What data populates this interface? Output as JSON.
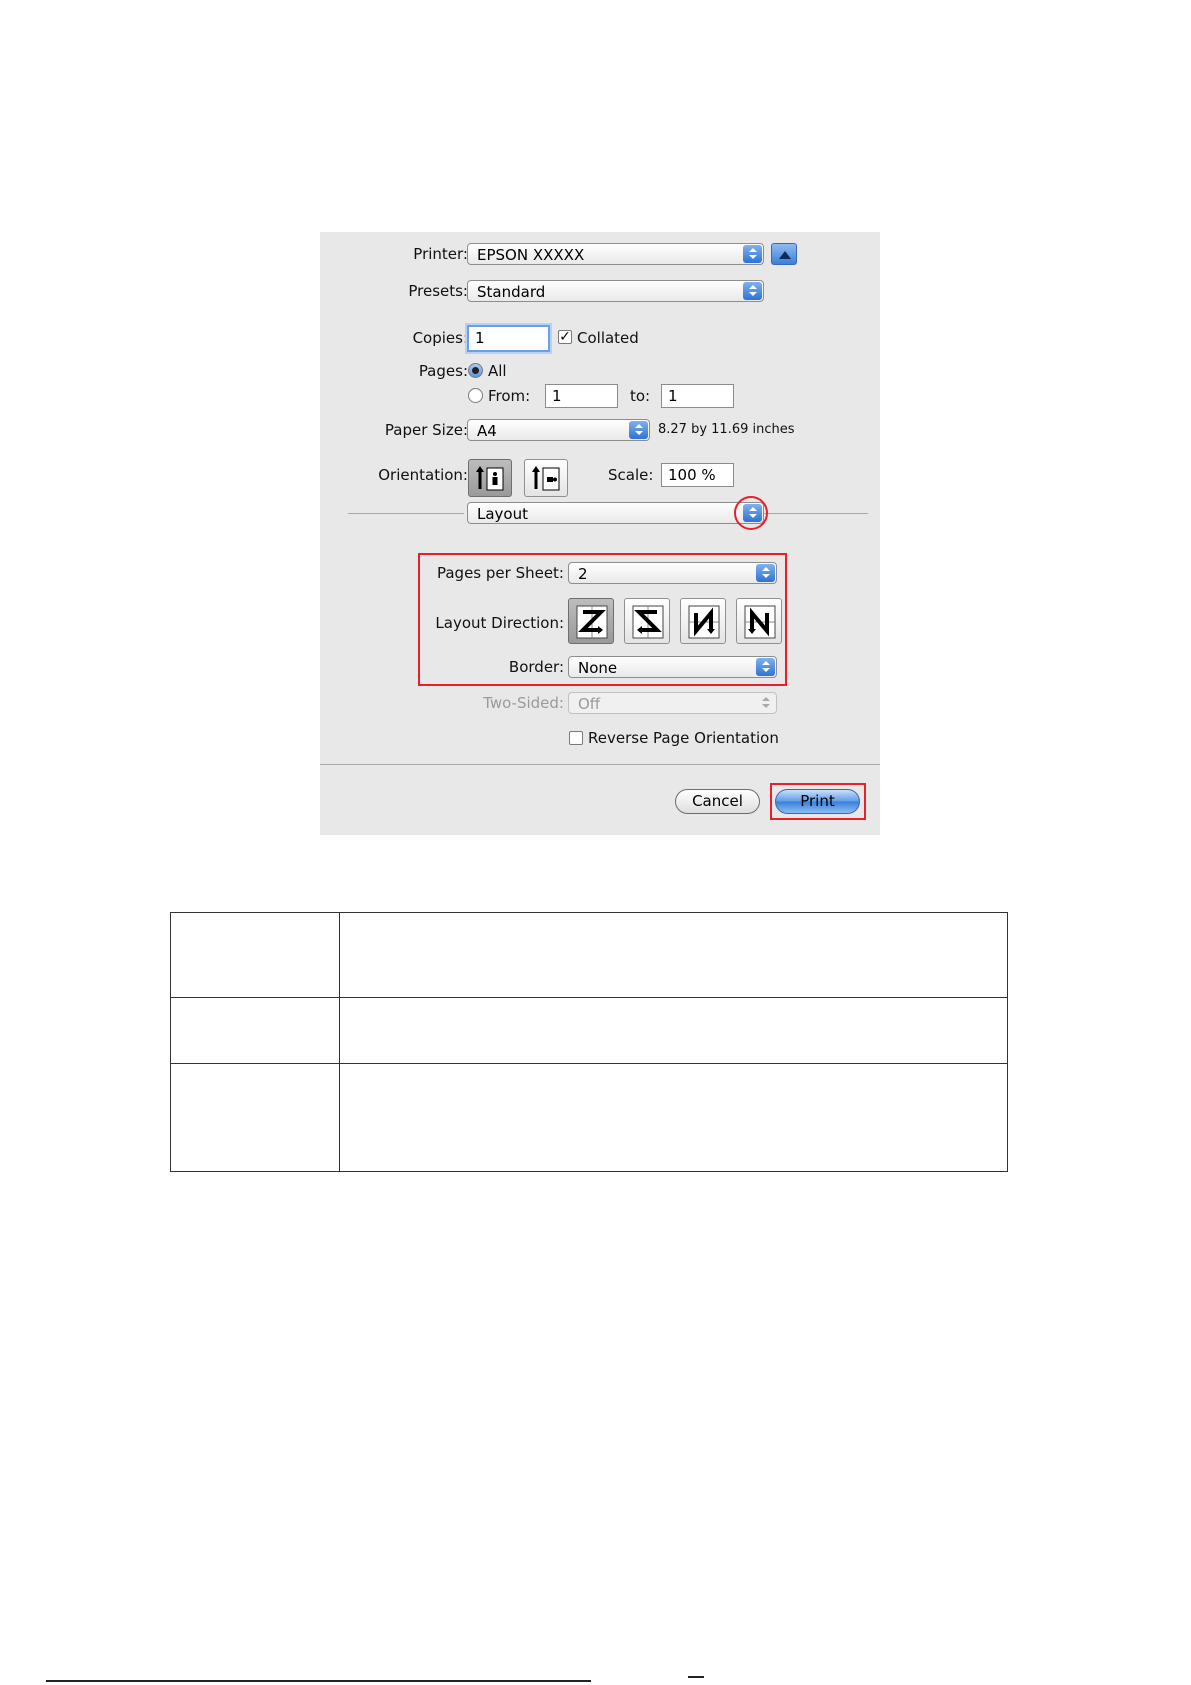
{
  "dialog": {
    "printer": {
      "label": "Printer:",
      "value": "EPSON XXXXX"
    },
    "presets": {
      "label": "Presets:",
      "value": "Standard"
    },
    "copies": {
      "label": "Copies:",
      "value": "1",
      "collated_label": "Collated",
      "collated_checked": true
    },
    "pages": {
      "label": "Pages:",
      "all_label": "All",
      "from_label": "From:",
      "from_value": "1",
      "to_label": "to:",
      "to_value": "1",
      "selected": "all"
    },
    "paper_size": {
      "label": "Paper Size:",
      "value": "A4",
      "dimensions": "8.27 by 11.69 inches"
    },
    "orientation": {
      "label": "Orientation:",
      "selected": "portrait",
      "icons": [
        "portrait-orientation-icon",
        "landscape-orientation-icon"
      ]
    },
    "scale": {
      "label": "Scale:",
      "value": "100 %"
    },
    "panel": {
      "value": "Layout"
    },
    "layout": {
      "pages_per_sheet": {
        "label": "Pages per Sheet:",
        "value": "2"
      },
      "layout_direction": {
        "label": "Layout Direction:",
        "selected_index": 0,
        "options": [
          "z-direction-icon",
          "reverse-z-direction-icon",
          "n-direction-icon",
          "reverse-n-direction-icon"
        ]
      },
      "border": {
        "label": "Border:",
        "value": "None"
      },
      "two_sided": {
        "label": "Two-Sided:",
        "value": "Off",
        "enabled": false
      },
      "reverse_orientation": {
        "label": "Reverse Page Orientation",
        "checked": false
      }
    },
    "buttons": {
      "cancel": "Cancel",
      "print": "Print"
    },
    "highlight_color": "#e8202a",
    "accent_color": "#3b7fd8"
  }
}
